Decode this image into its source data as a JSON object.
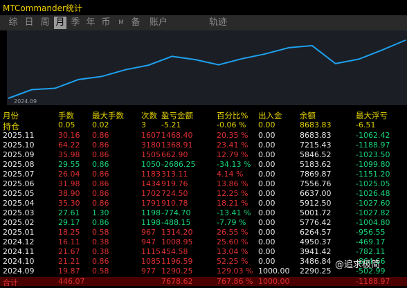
{
  "title": "MTCommander统计",
  "tabs": [
    "综",
    "日",
    "周",
    "月",
    "季",
    "年",
    "币",
    "M",
    "备",
    "账户",
    "轨迹"
  ],
  "active_tab": "月",
  "chart_data": {
    "type": "line",
    "x_label": "2024.09",
    "series": [
      {
        "values": [
          0,
          1290,
          1496,
          2805,
          3266,
          4260,
          4950,
          6264,
          5776,
          5001,
          5912,
          6637,
          7556,
          7869,
          5183,
          5846,
          7215,
          8683
        ]
      }
    ]
  },
  "headers": [
    "月份",
    "手数",
    "最大手数",
    "次数",
    "盈亏金额",
    "百分比%",
    "出入金",
    "余额",
    "最大浮亏"
  ],
  "hold_row": [
    "持仓",
    "0.05",
    "0.02",
    "3",
    "-5.21",
    "-0.06 %",
    "0.00",
    "8683.83",
    "-6.51"
  ],
  "rows": [
    [
      "2025.11",
      "30.16",
      "0.86",
      "1607",
      "1468.40",
      "20.35 %",
      "0.00",
      "8683.83",
      "-1062.42",
      "neg"
    ],
    [
      "2025.10",
      "64.22",
      "0.86",
      "3180",
      "1368.91",
      "23.41 %",
      "0.00",
      "7215.43",
      "-1188.97",
      "neg"
    ],
    [
      "2025.09",
      "35.98",
      "0.86",
      "1505",
      "662.90",
      "12.79 %",
      "0.00",
      "5846.52",
      "-1023.50",
      "neg"
    ],
    [
      "2025.08",
      "29.55",
      "0.86",
      "1050",
      "-2686.25",
      "-34.13 %",
      "0.00",
      "5183.62",
      "-1099.80",
      "pos"
    ],
    [
      "2025.07",
      "26.04",
      "0.86",
      "1183",
      "313.11",
      "4.14 %",
      "0.00",
      "7869.87",
      "-1151.20",
      "neg"
    ],
    [
      "2025.06",
      "31.98",
      "0.86",
      "1434",
      "919.76",
      "13.86 %",
      "0.00",
      "7556.76",
      "-1025.05",
      "neg"
    ],
    [
      "2025.05",
      "38.90",
      "0.86",
      "1702",
      "724.50",
      "12.25 %",
      "0.00",
      "6637.00",
      "-1026.48",
      "neg"
    ],
    [
      "2025.04",
      "35.30",
      "0.86",
      "1791",
      "910.78",
      "18.21 %",
      "0.00",
      "5912.50",
      "-1027.60",
      "neg"
    ],
    [
      "2025.03",
      "27.61",
      "1.30",
      "1198",
      "-774.70",
      "-13.41 %",
      "0.00",
      "5001.72",
      "-1027.82",
      "pos"
    ],
    [
      "2025.02",
      "29.17",
      "0.86",
      "1198",
      "-488.15",
      "-7.79 %",
      "0.00",
      "5776.42",
      "-1004.80",
      "pos"
    ],
    [
      "2025.01",
      "18.25",
      "0.58",
      "967",
      "1314.20",
      "26.55 %",
      "0.00",
      "6264.57",
      "-956.55",
      "neg"
    ],
    [
      "2024.12",
      "16.11",
      "0.38",
      "947",
      "1008.95",
      "25.60 %",
      "0.00",
      "4950.37",
      "-469.17",
      "neg"
    ],
    [
      "2024.11",
      "21.67",
      "0.38",
      "1115",
      "454.58",
      "13.04 %",
      "0.00",
      "3941.42",
      "-782.11",
      "neg"
    ],
    [
      "2024.10",
      "21.21",
      "0.86",
      "1085",
      "1196.59",
      "52.25 %",
      "0.00",
      "3486.84",
      "-864.66",
      "neg"
    ],
    [
      "2024.09",
      "19.87",
      "0.58",
      "977",
      "1290.25",
      "129.03 %",
      "1000.00",
      "2290.25",
      "-502.99",
      "neg"
    ]
  ],
  "total_row": [
    "合计",
    "446.07",
    "",
    "",
    "7678.62",
    "767.86 %",
    "1000.00",
    "",
    "-1188.97"
  ],
  "watermark": "@追求极简"
}
